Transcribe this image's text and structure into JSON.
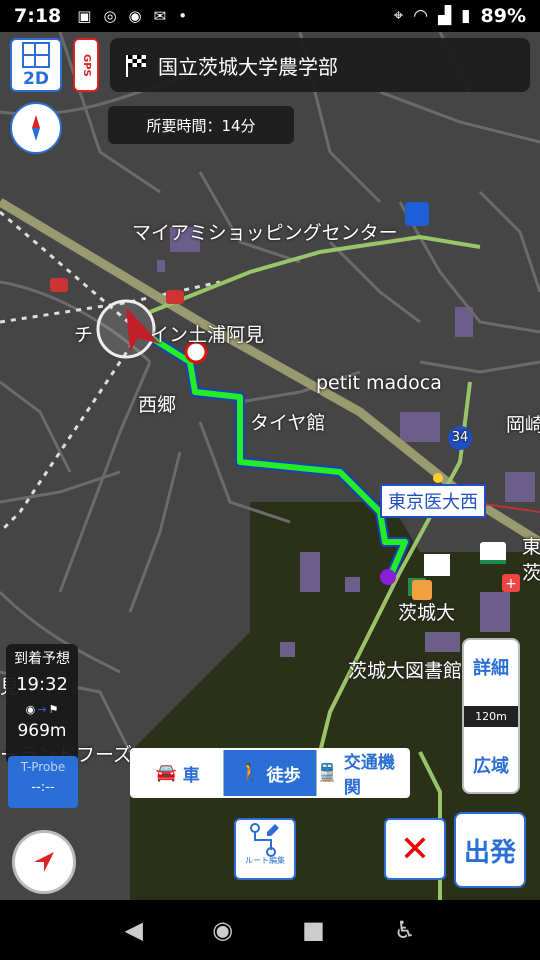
{
  "status_bar": {
    "time": "7:18",
    "battery": "89%"
  },
  "toolbar": {
    "view_mode": "2D",
    "gps_label": "GPS"
  },
  "destination": {
    "name": "国立茨城大学農学部"
  },
  "travel_time": {
    "label": "所要時間：14分"
  },
  "map_labels": {
    "shopping": "マイアミショッピングセンター",
    "inn": "チ",
    "inn2": "イン土浦阿見",
    "petit": "petit madoca",
    "nishigo": "西郷",
    "taiya": "タイヤ館",
    "okazaki": "岡崎",
    "route34": "34",
    "tokyo_med": "東京医大西",
    "higashi": "東",
    "ibaraki_u": "茨城大",
    "library": "茨城大図書館",
    "landfors": "ーランドフーズ",
    "mi": "見",
    "ki": "茨"
  },
  "arrival": {
    "title": "到着予想",
    "time": "19:32",
    "distance": "969m",
    "tprobe": "T-Probe",
    "tprobe_value": "--:--"
  },
  "modes": [
    {
      "label": "車",
      "icon": "car-icon",
      "active": false
    },
    {
      "label": "徒歩",
      "icon": "walk-icon",
      "active": true
    },
    {
      "label": "交通機関",
      "icon": "train-icon",
      "active": false
    }
  ],
  "zoom": {
    "detail": "詳細",
    "wide": "広域",
    "scale": "120m"
  },
  "route_edit": {
    "label": "ルート編集"
  },
  "depart": {
    "label": "出発"
  },
  "colors": {
    "accent": "#2b6fd6",
    "route": "#22ee22",
    "route_outline": "#1a3fbf",
    "map_bg": "#454545",
    "green_area": "#2b3118"
  }
}
